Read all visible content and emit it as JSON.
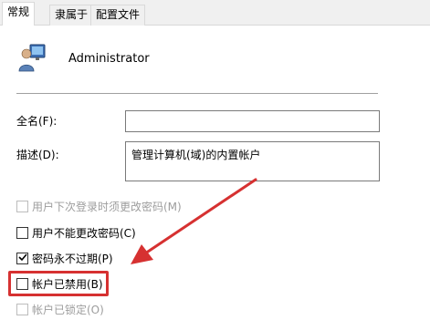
{
  "tabs": [
    {
      "label": "常规"
    },
    {
      "label": "隶属于"
    },
    {
      "label": "配置文件"
    }
  ],
  "user": {
    "name": "Administrator"
  },
  "fields": {
    "fullname_label": "全名(F):",
    "fullname_value": "",
    "description_label": "描述(D):",
    "description_value": "管理计算机(域)的内置帐户"
  },
  "checkboxes": [
    {
      "label": "用户下次登录时须更改密码(M)",
      "checked": false,
      "enabled": false
    },
    {
      "label": "用户不能更改密码(C)",
      "checked": false,
      "enabled": true
    },
    {
      "label": "密码永不过期(P)",
      "checked": true,
      "enabled": true
    },
    {
      "label": "帐户已禁用(B)",
      "checked": false,
      "enabled": true
    },
    {
      "label": "帐户已锁定(O)",
      "checked": false,
      "enabled": false
    }
  ],
  "colors": {
    "annotation": "#d63131",
    "tab_background": "#f0f0f0",
    "disabled_text": "#9d9d9d"
  },
  "annotation": {
    "highlighted_item": "帐户已禁用(B)",
    "arrow_icon": "red-arrow"
  }
}
